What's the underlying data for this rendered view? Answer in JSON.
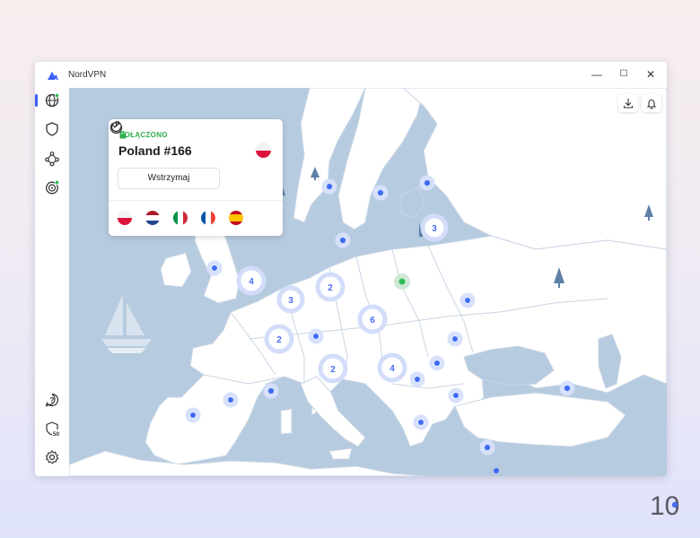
{
  "app": {
    "title": "NordVPN"
  },
  "window_controls": {
    "minimize": "—",
    "maximize": "☐",
    "close": "✕"
  },
  "sidebar": {
    "items": [
      {
        "name": "map",
        "icon": "globe-icon",
        "active": true
      },
      {
        "name": "threat-protection",
        "icon": "shield-icon"
      },
      {
        "name": "meshnet",
        "icon": "meshnet-icon"
      },
      {
        "name": "dark-web-monitor",
        "icon": "radar-icon"
      }
    ],
    "bottom": [
      {
        "name": "help",
        "icon": "help-icon"
      },
      {
        "name": "protection-score",
        "icon": "shield-score-icon",
        "badge": "50"
      },
      {
        "name": "settings",
        "icon": "gear-icon"
      }
    ]
  },
  "connection": {
    "status": "POŁĄCZONO",
    "server": "Poland #166",
    "country_flag": "poland-flag",
    "pause_label": "Wstrzymaj",
    "recent_flags": [
      "poland-flag",
      "netherlands-flag",
      "italy-flag",
      "france-flag",
      "spain-flag"
    ]
  },
  "map": {
    "clusters": [
      "4",
      "3",
      "2",
      "6",
      "2",
      "2",
      "4",
      "3"
    ],
    "colors": {
      "water": "#b7cbe0",
      "land": "#ffffff",
      "border": "#c9d6e4",
      "marker": "#3e6bf5",
      "connected": "#2fbe55"
    }
  },
  "zoom": {
    "out": "–",
    "in": "+"
  },
  "brand_badge": "10"
}
